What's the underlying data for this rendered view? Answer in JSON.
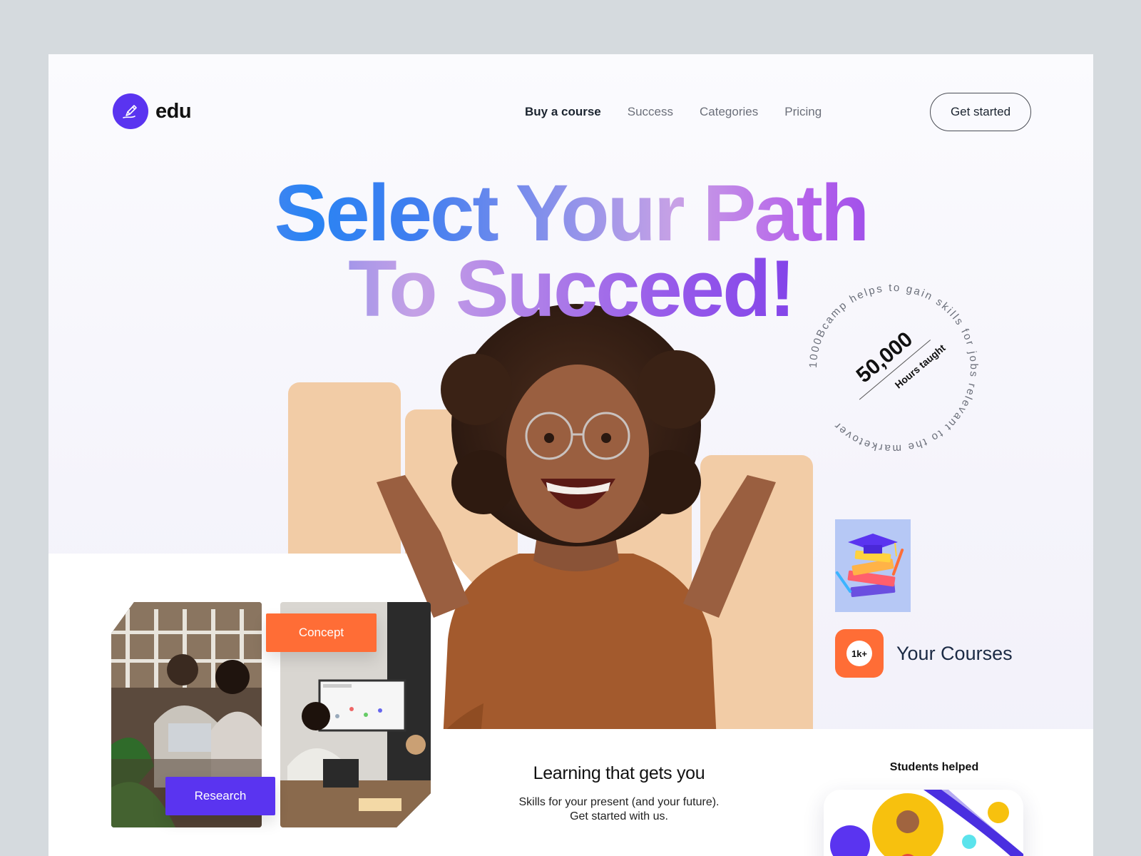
{
  "brand": {
    "name": "edu",
    "logo_icon": "pen-nib-icon",
    "logo_color": "#5a34f0"
  },
  "nav": {
    "items": [
      {
        "label": "Buy a course",
        "active": true
      },
      {
        "label": "Success",
        "active": false
      },
      {
        "label": "Categories",
        "active": false
      },
      {
        "label": "Pricing",
        "active": false
      }
    ],
    "cta_label": "Get started"
  },
  "hero": {
    "headline_line1": "Select Your Path",
    "headline_line2": "To Succeed!"
  },
  "badge": {
    "value": "50,000",
    "label": "Hours taught",
    "ring_text": "1000Bcamp helps to gain skills for jobs relevant to the marketover "
  },
  "courses": {
    "badge": "1k+",
    "label": "Your Courses",
    "accent": "#ff6d36"
  },
  "tags": {
    "concept": "Concept",
    "research": "Research"
  },
  "learning": {
    "title": "Learning that gets you",
    "line1": "Skills for your present (and your future).",
    "line2": "Get started with us."
  },
  "students": {
    "label": "Students helped"
  },
  "colors": {
    "purple": "#5a34f0",
    "orange": "#ff6d36",
    "peach": "#f2cca6"
  }
}
